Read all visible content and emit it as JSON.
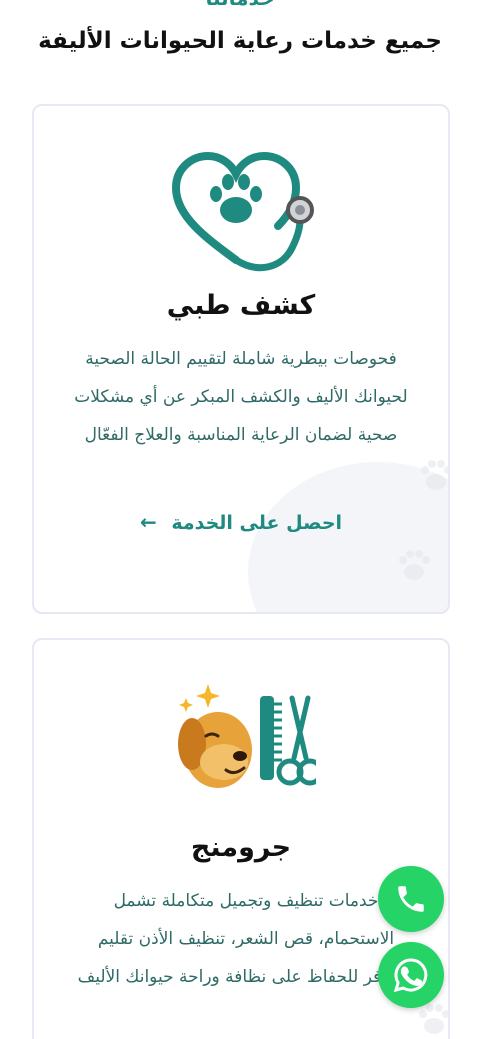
{
  "section": {
    "eyebrow": "خدماتنا",
    "title": "جميع خدمات رعاية الحيوانات الأليفة"
  },
  "services": [
    {
      "icon": "stethoscope-heart-paw-icon",
      "title": "كشف طبي",
      "description": "فحوصات بيطرية شاملة لتقييم الحالة الصحية لحيوانك الأليف والكشف المبكر عن أي مشكلات صحية لضمان الرعاية المناسبة والعلاج الفعّال",
      "cta": "احصل على الخدمة"
    },
    {
      "icon": "dog-grooming-comb-scissors-icon",
      "title": "جرومنج",
      "description": "خدمات تنظيف وتجميل متكاملة تشمل الاستحمام، قص الشعر، تنظيف الأذن تقليم الأظافر للحفاظ على نظافة وراحة حيوانك الأليف"
    }
  ],
  "floating_buttons": {
    "phone_icon": "phone-icon",
    "whatsapp_icon": "whatsapp-icon"
  },
  "colors": {
    "accent": "#1f8a80",
    "text_muted": "#2f6a66",
    "whatsapp": "#25d366"
  }
}
